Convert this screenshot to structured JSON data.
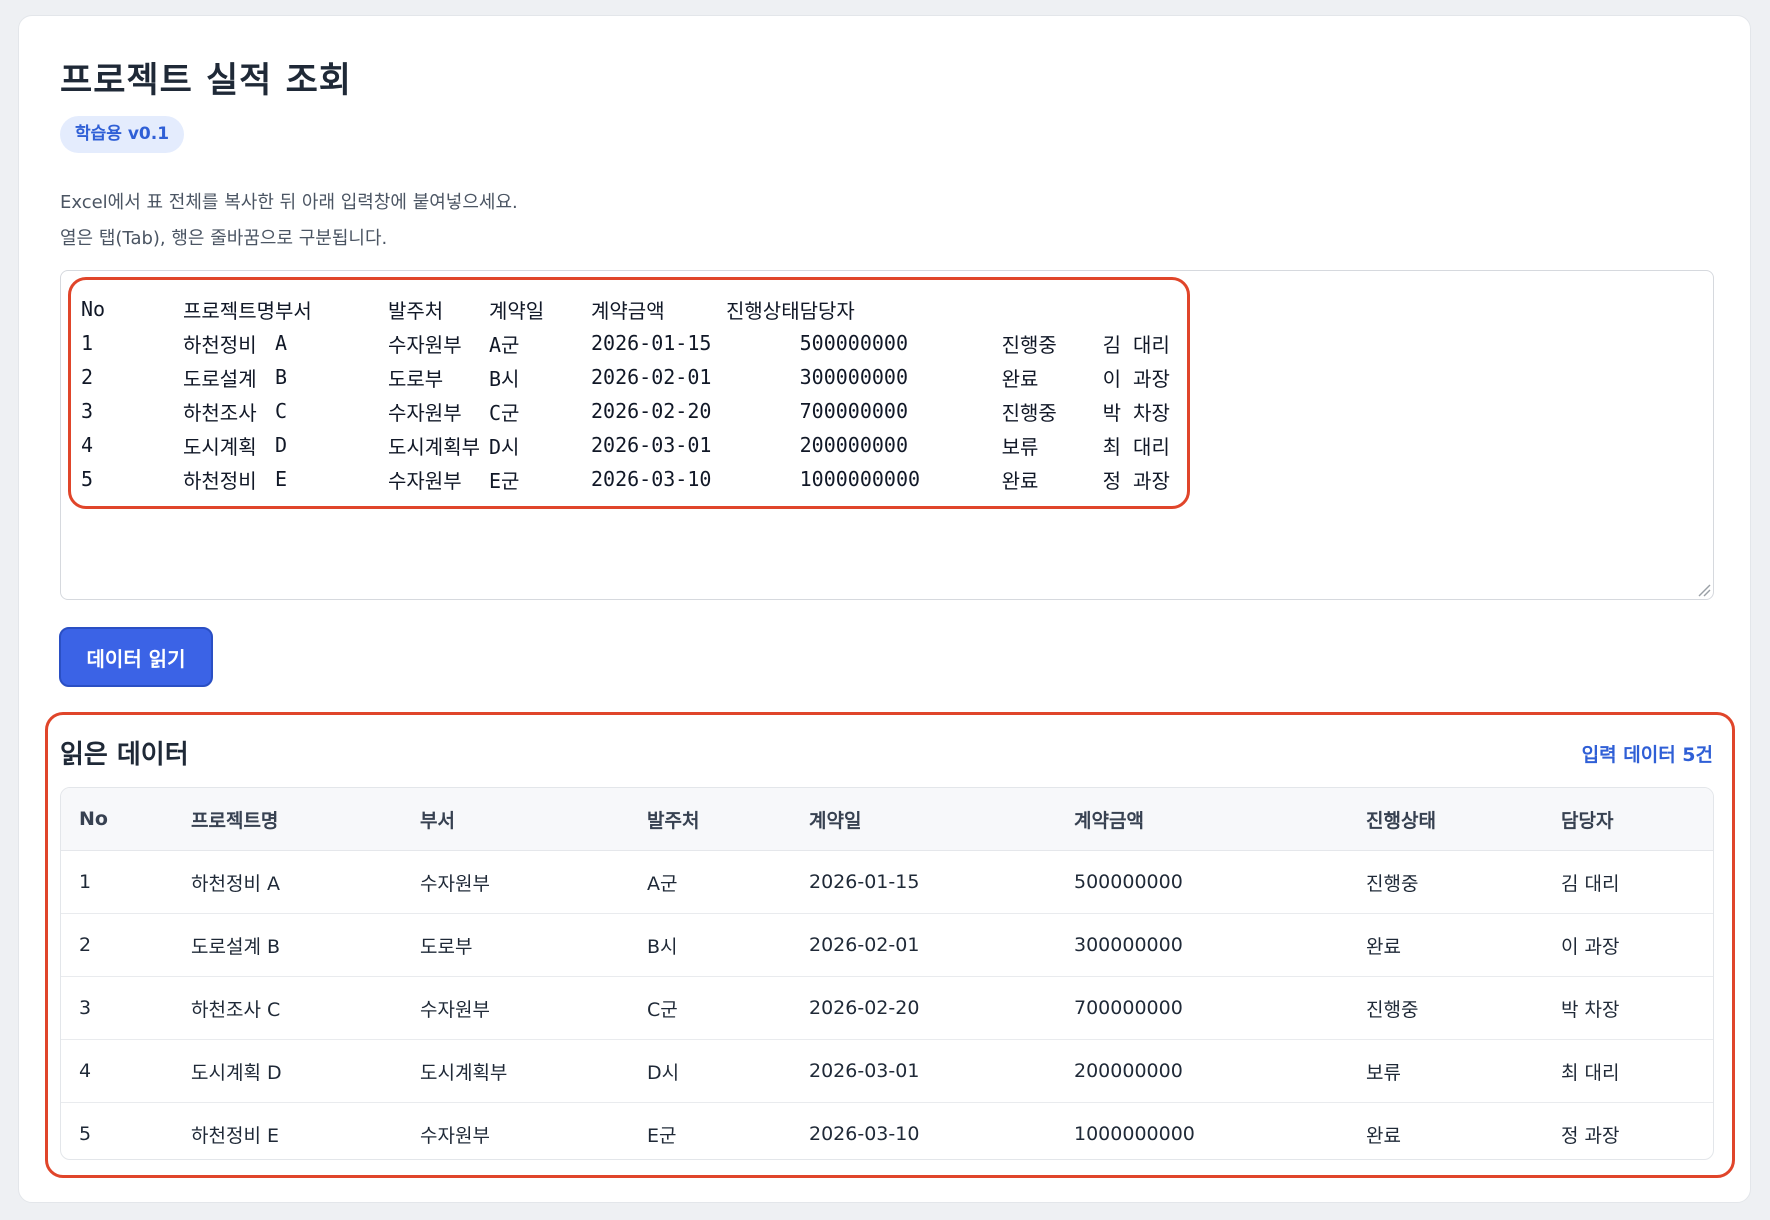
{
  "header": {
    "title": "프로젝트 실적 조회",
    "badge": "학습용 v0.1"
  },
  "instructions": {
    "line1": "Excel에서 표 전체를 복사한 뒤 아래 입력창에 붙여넣으세요.",
    "line2": "열은 탭(Tab), 행은 줄바꿈으로 구분됩니다."
  },
  "paste_input": {
    "rows": [
      [
        "No",
        "프로젝트명",
        "부서",
        "발주처",
        "계약일",
        "계약금액",
        "진행상태",
        "담당자",
        "",
        ""
      ],
      [
        "1",
        "하천정비",
        "A",
        "수자원부",
        "A군",
        "2026-01-15",
        "",
        "500000000",
        "진행중",
        "김 대리"
      ],
      [
        "2",
        "도로설계",
        "B",
        "도로부",
        "B시",
        "2026-02-01",
        "",
        "300000000",
        "완료",
        "이 과장"
      ],
      [
        "3",
        "하천조사",
        "C",
        "수자원부",
        "C군",
        "2026-02-20",
        "",
        "700000000",
        "진행중",
        "박 차장"
      ],
      [
        "4",
        "도시계획",
        "D",
        "도시계획부",
        "D시",
        "2026-03-01",
        "",
        "200000000",
        "보류",
        "최 대리"
      ],
      [
        "5",
        "하천정비",
        "E",
        "수자원부",
        "E군",
        "2026-03-10",
        "",
        "1000000000",
        "완료",
        "정 과장"
      ]
    ]
  },
  "read_button": {
    "label": "데이터 읽기"
  },
  "result": {
    "title": "읽은 데이터",
    "count_label": "입력 데이터 5건",
    "columns": [
      "No",
      "프로젝트명",
      "부서",
      "발주처",
      "계약일",
      "계약금액",
      "진행상태",
      "담당자"
    ],
    "rows": [
      [
        "1",
        "하천정비 A",
        "수자원부",
        "A군",
        "2026-01-15",
        "500000000",
        "진행중",
        "김 대리"
      ],
      [
        "2",
        "도로설계 B",
        "도로부",
        "B시",
        "2026-02-01",
        "300000000",
        "완료",
        "이 과장"
      ],
      [
        "3",
        "하천조사 C",
        "수자원부",
        "C군",
        "2026-02-20",
        "700000000",
        "진행중",
        "박 차장"
      ],
      [
        "4",
        "도시계획 D",
        "도시계획부",
        "D시",
        "2026-03-01",
        "200000000",
        "보류",
        "최 대리"
      ],
      [
        "5",
        "하천정비 E",
        "수자원부",
        "E군",
        "2026-03-10",
        "1000000000",
        "완료",
        "정 과장"
      ]
    ]
  },
  "colors": {
    "accent": "#3b63e6",
    "highlight": "#e0452a",
    "badge_bg": "#e4ecfd",
    "link": "#2f5fd6"
  },
  "icons": {
    "resize": "resize-grip-icon"
  }
}
